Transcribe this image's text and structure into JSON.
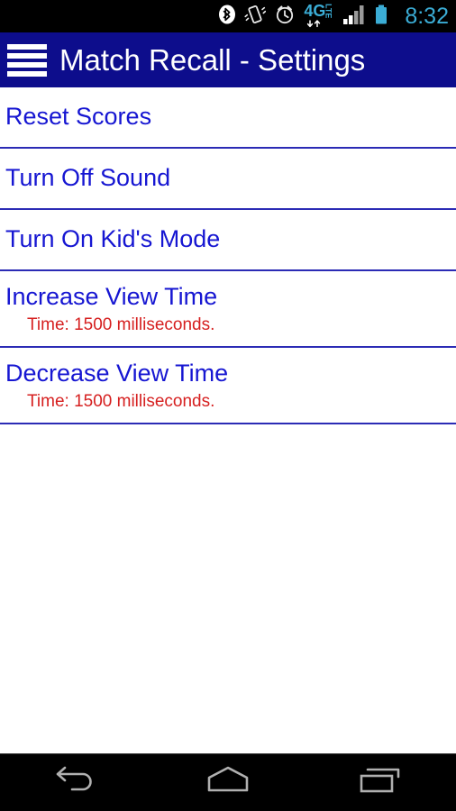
{
  "status_bar": {
    "time": "8:32",
    "icons": [
      {
        "name": "bluetooth-icon",
        "label": "Bluetooth"
      },
      {
        "name": "vibrate-icon",
        "label": "Vibrate mode"
      },
      {
        "name": "alarm-icon",
        "label": "Alarm set"
      },
      {
        "name": "network-4glte-icon",
        "label": "4G LTE"
      },
      {
        "name": "signal-bars-icon",
        "label": "Signal strength"
      },
      {
        "name": "battery-icon",
        "label": "Battery"
      }
    ],
    "network_label": "4G",
    "network_sub_label": "LTE",
    "colors": {
      "background": "#000000",
      "time_text": "#3badd6",
      "battery": "#3badd6"
    }
  },
  "app_bar": {
    "title": "Match Recall - Settings",
    "menu_icon": "hamburger-menu-icon",
    "colors": {
      "background": "#0d0d8c",
      "title_text": "#ffffff"
    }
  },
  "settings_list": {
    "colors": {
      "item_title": "#1616d2",
      "item_subtitle": "#d62020",
      "divider": "#2b2bb5",
      "background": "#ffffff"
    },
    "items": [
      {
        "id": "reset-scores",
        "title": "Reset Scores",
        "subtitle": null
      },
      {
        "id": "turn-off-sound",
        "title": "Turn Off Sound",
        "subtitle": null
      },
      {
        "id": "turn-on-kids-mode",
        "title": "Turn On Kid's Mode",
        "subtitle": null
      },
      {
        "id": "increase-view-time",
        "title": "Increase View Time",
        "subtitle": "Time: 1500 milliseconds."
      },
      {
        "id": "decrease-view-time",
        "title": "Decrease View Time",
        "subtitle": "Time: 1500 milliseconds."
      }
    ]
  },
  "navigation_bar": {
    "buttons": [
      {
        "id": "back",
        "icon": "back-arrow-icon",
        "label": "Back"
      },
      {
        "id": "home",
        "icon": "home-icon",
        "label": "Home"
      },
      {
        "id": "recents",
        "icon": "recents-icon",
        "label": "Recent apps"
      }
    ],
    "colors": {
      "background": "#000000",
      "icon": "#b0b0b0"
    }
  }
}
